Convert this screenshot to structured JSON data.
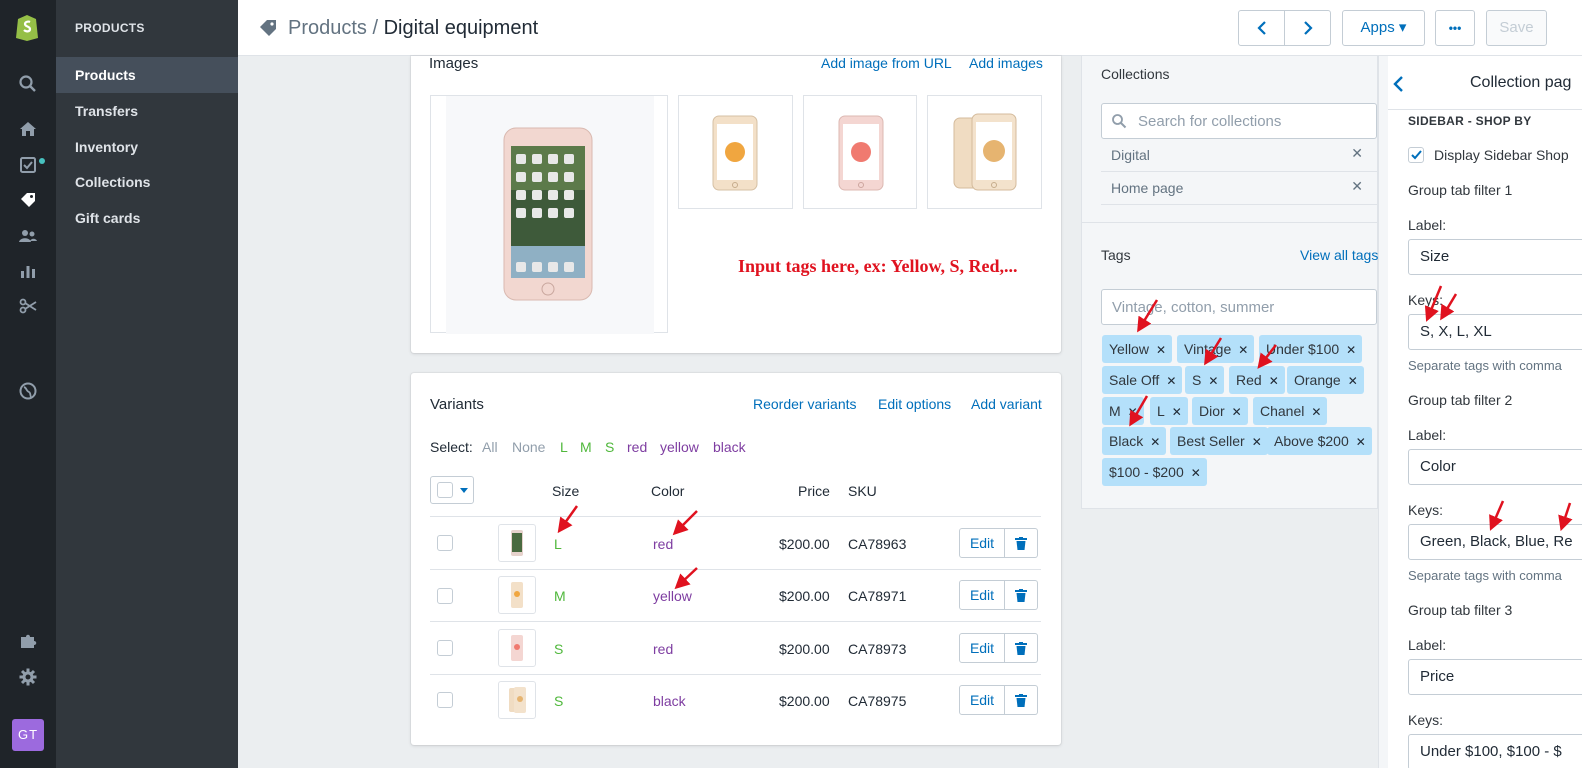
{
  "nav": {
    "section": "PRODUCTS",
    "items": [
      "Products",
      "Transfers",
      "Inventory",
      "Collections",
      "Gift cards"
    ],
    "avatar": "GT"
  },
  "topbar": {
    "crumb_parent": "Products",
    "crumb_sep": " / ",
    "crumb_current": "Digital equipment",
    "apps_label": "Apps ▾",
    "more_label": "•••",
    "save_label": "Save"
  },
  "images": {
    "title": "Images",
    "add_url": "Add image from URL",
    "add_images": "Add images"
  },
  "annotation": "Input tags here, ex: Yellow, S, Red,...",
  "variants": {
    "title": "Variants",
    "reorder": "Reorder variants",
    "edit_options": "Edit options",
    "add_variant": "Add variant",
    "select_label": "Select:",
    "select_options": [
      "All",
      "None",
      "L",
      "M",
      "S",
      "red",
      "yellow",
      "black"
    ],
    "headers": {
      "size": "Size",
      "color": "Color",
      "price": "Price",
      "sku": "SKU"
    },
    "edit_label": "Edit",
    "rows": [
      {
        "size": "L",
        "color": "red",
        "price": "$200.00",
        "sku": "CA78963"
      },
      {
        "size": "M",
        "color": "yellow",
        "price": "$200.00",
        "sku": "CA78971"
      },
      {
        "size": "S",
        "color": "red",
        "price": "$200.00",
        "sku": "CA78973"
      },
      {
        "size": "S",
        "color": "black",
        "price": "$200.00",
        "sku": "CA78975"
      }
    ]
  },
  "collections": {
    "title": "Collections",
    "search_placeholder": "Search for collections",
    "items": [
      "Digital",
      "Home page"
    ]
  },
  "tags": {
    "title": "Tags",
    "view_all": "View all tags",
    "placeholder": "Vintage, cotton, summer",
    "chips": [
      "Yellow",
      "Vintage",
      "Under $100",
      "Sale Off",
      "S",
      "Red",
      "Orange",
      "M",
      "L",
      "Dior",
      "Chanel",
      "Black",
      "Best Seller",
      "Above $200",
      "$100 - $200"
    ]
  },
  "settings": {
    "title": "Collection pag",
    "section": "SIDEBAR - SHOP BY",
    "display_label": "Display Sidebar Shop",
    "group1": "Group tab filter 1",
    "group2": "Group tab filter 2",
    "group3": "Group tab filter 3",
    "label_text": "Label:",
    "keys_text": "Keys:",
    "help": "Separate tags with comma",
    "label1": "Size",
    "keys1": "S, X, L, XL",
    "label2": "Color",
    "keys2": "Green, Black, Blue, Re",
    "label3": "Price",
    "keys3": "Under $100, $100 - $"
  },
  "colors": {
    "accent": "#006fbb",
    "tag_chip": "#b4e0fa",
    "size_text": "#50b83c",
    "color_text": "#7e3da1",
    "annotation": "#e0121f",
    "avatar": "#9c6ade"
  },
  "icons": [
    "shopify-logo-icon",
    "search-icon",
    "home-icon",
    "orders-icon",
    "products-tag-icon",
    "customers-icon",
    "analytics-icon",
    "discounts-icon",
    "online-store-globe-icon",
    "apps-puzzle-icon",
    "settings-gear-icon",
    "chevron-left-icon",
    "chevron-right-icon",
    "trash-icon",
    "close-icon",
    "checkmark-icon",
    "red-arrow-icon"
  ]
}
